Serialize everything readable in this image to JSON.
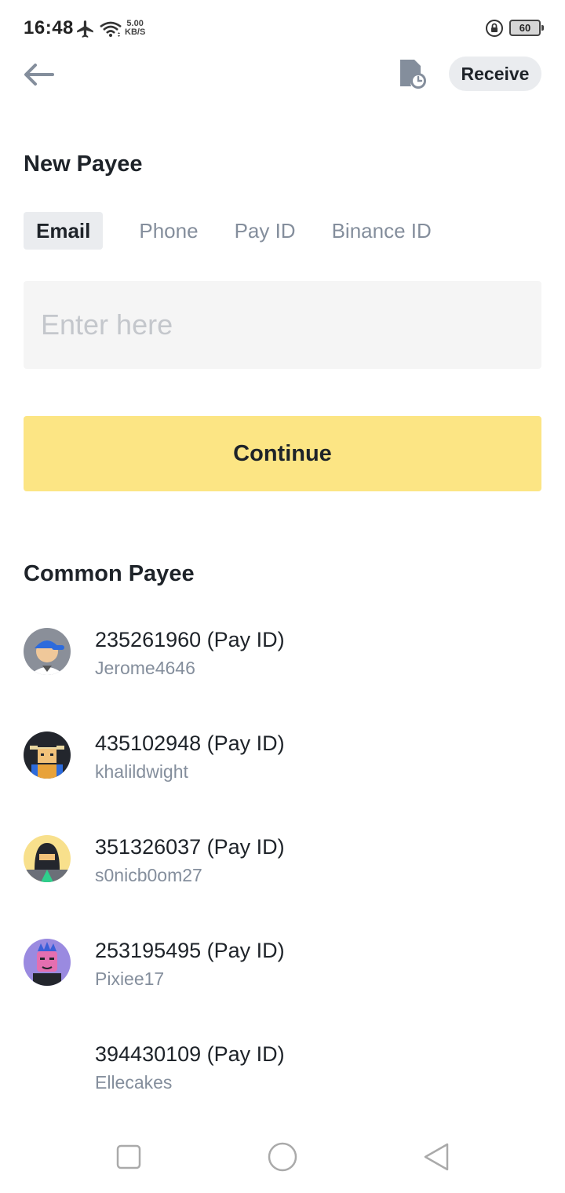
{
  "status_bar": {
    "time": "16:48",
    "speed_value": "5.00",
    "speed_unit": "KB/S",
    "battery": "60",
    "icons": [
      "airplane-icon",
      "wifi-icon",
      "rotation-lock-icon",
      "battery-icon"
    ]
  },
  "header": {
    "back_icon": "arrow-left-icon",
    "history_icon": "document-clock-icon",
    "receive_label": "Receive"
  },
  "new_payee": {
    "title": "New Payee",
    "tabs": [
      {
        "label": "Email",
        "active": true
      },
      {
        "label": "Phone",
        "active": false
      },
      {
        "label": "Pay ID",
        "active": false
      },
      {
        "label": "Binance ID",
        "active": false
      }
    ],
    "input_placeholder": "Enter here",
    "input_value": "",
    "continue_label": "Continue"
  },
  "common_payee": {
    "title": "Common Payee",
    "items": [
      {
        "id": "235261960 (Pay ID)",
        "name": "Jerome4646",
        "avatar": "cap-avatar"
      },
      {
        "id": "435102948 (Pay ID)",
        "name": "khalildwight",
        "avatar": "hat-avatar"
      },
      {
        "id": "351326037 (Pay ID)",
        "name": "s0nicb0om27",
        "avatar": "hood-avatar"
      },
      {
        "id": "253195495 (Pay ID)",
        "name": "Pixiee17",
        "avatar": "punk-avatar"
      },
      {
        "id": "394430109 (Pay ID)",
        "name": "Ellecakes",
        "avatar": ""
      }
    ]
  },
  "nav_bar": {
    "icons": [
      "square-recents-icon",
      "circle-home-icon",
      "triangle-back-icon"
    ]
  },
  "colors": {
    "accent_yellow": "#fce584",
    "text_primary": "#1e2329",
    "text_secondary": "#848e9c",
    "input_bg": "#f5f5f5",
    "chip_bg": "#eaecef"
  }
}
